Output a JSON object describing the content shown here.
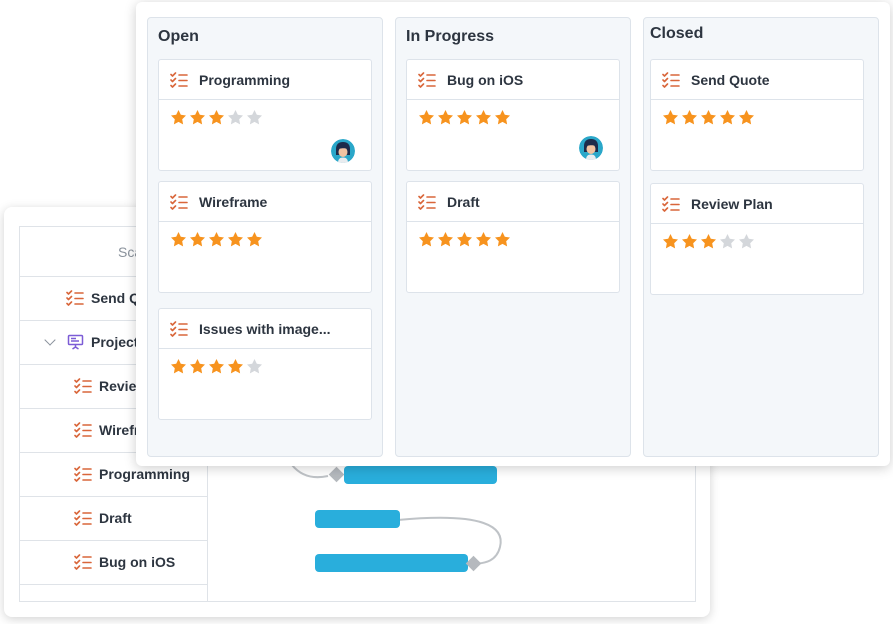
{
  "colors": {
    "bar": "#29aedc",
    "star_on": "#f7931e",
    "star_off": "#d4d7db",
    "task_icon": "#d9663a",
    "project_icon": "#7c5cd6"
  },
  "gantt": {
    "header": "Sca",
    "rows": [
      {
        "label": "Send Q",
        "icon": "task-list-icon"
      },
      {
        "label": "Project",
        "icon": "project-board-icon"
      },
      {
        "label": "Reviev",
        "icon": "task-list-icon"
      },
      {
        "label": "Wirefr",
        "icon": "task-list-icon"
      },
      {
        "label": "Programming",
        "icon": "task-list-icon"
      },
      {
        "label": "Draft",
        "icon": "task-list-icon"
      },
      {
        "label": "Bug on iOS",
        "icon": "task-list-icon"
      }
    ]
  },
  "board": {
    "columns": [
      {
        "title": "Open",
        "cards": [
          {
            "title": "Programming",
            "rating": 3,
            "avatar": true
          },
          {
            "title": "Wireframe",
            "rating": 5
          },
          {
            "title": "Issues with image...",
            "rating": 4
          }
        ]
      },
      {
        "title": "In Progress",
        "cards": [
          {
            "title": "Bug on iOS",
            "rating": 5,
            "avatar": true
          },
          {
            "title": "Draft",
            "rating": 5
          }
        ]
      },
      {
        "title": "Closed",
        "cards": [
          {
            "title": "Send Quote",
            "rating": 5
          },
          {
            "title": "Review Plan",
            "rating": 3
          }
        ]
      }
    ]
  }
}
